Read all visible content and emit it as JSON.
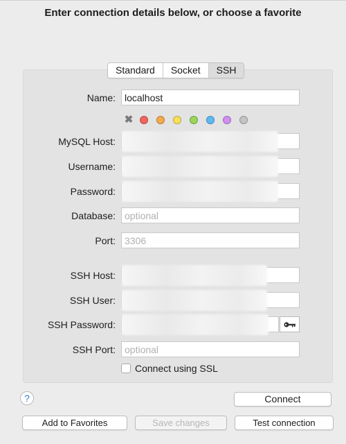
{
  "header": {
    "title": "Enter connection details below, or choose a favorite"
  },
  "tabs": [
    {
      "label": "Standard",
      "active": false
    },
    {
      "label": "Socket",
      "active": false
    },
    {
      "label": "SSH",
      "active": true
    }
  ],
  "fields": {
    "name": {
      "label": "Name:",
      "value": "localhost"
    },
    "mysql_host": {
      "label": "MySQL Host:",
      "value": ""
    },
    "username": {
      "label": "Username:",
      "value": ""
    },
    "password": {
      "label": "Password:",
      "value": ""
    },
    "database": {
      "label": "Database:",
      "placeholder": "optional"
    },
    "port": {
      "label": "Port:",
      "placeholder": "3306"
    },
    "ssh_host": {
      "label": "SSH Host:",
      "value": ""
    },
    "ssh_user": {
      "label": "SSH User:",
      "value": ""
    },
    "ssh_password": {
      "label": "SSH Password:",
      "value": ""
    },
    "ssh_port": {
      "label": "SSH Port:",
      "placeholder": "optional"
    }
  },
  "color_tags": {
    "clear_symbol": "✖",
    "colors": [
      "#f2665b",
      "#f5a94e",
      "#f7e05a",
      "#9ad65b",
      "#5fb8f2",
      "#d18ff0",
      "#c4c4c4"
    ]
  },
  "ssl": {
    "label": "Connect using SSL",
    "checked": false
  },
  "buttons": {
    "help": "?",
    "connect": "Connect",
    "add_favorites": "Add to Favorites",
    "save_changes": "Save changes",
    "test_connection": "Test connection"
  },
  "icons": {
    "key": "key-icon",
    "help": "help-icon",
    "clear": "close-icon"
  }
}
